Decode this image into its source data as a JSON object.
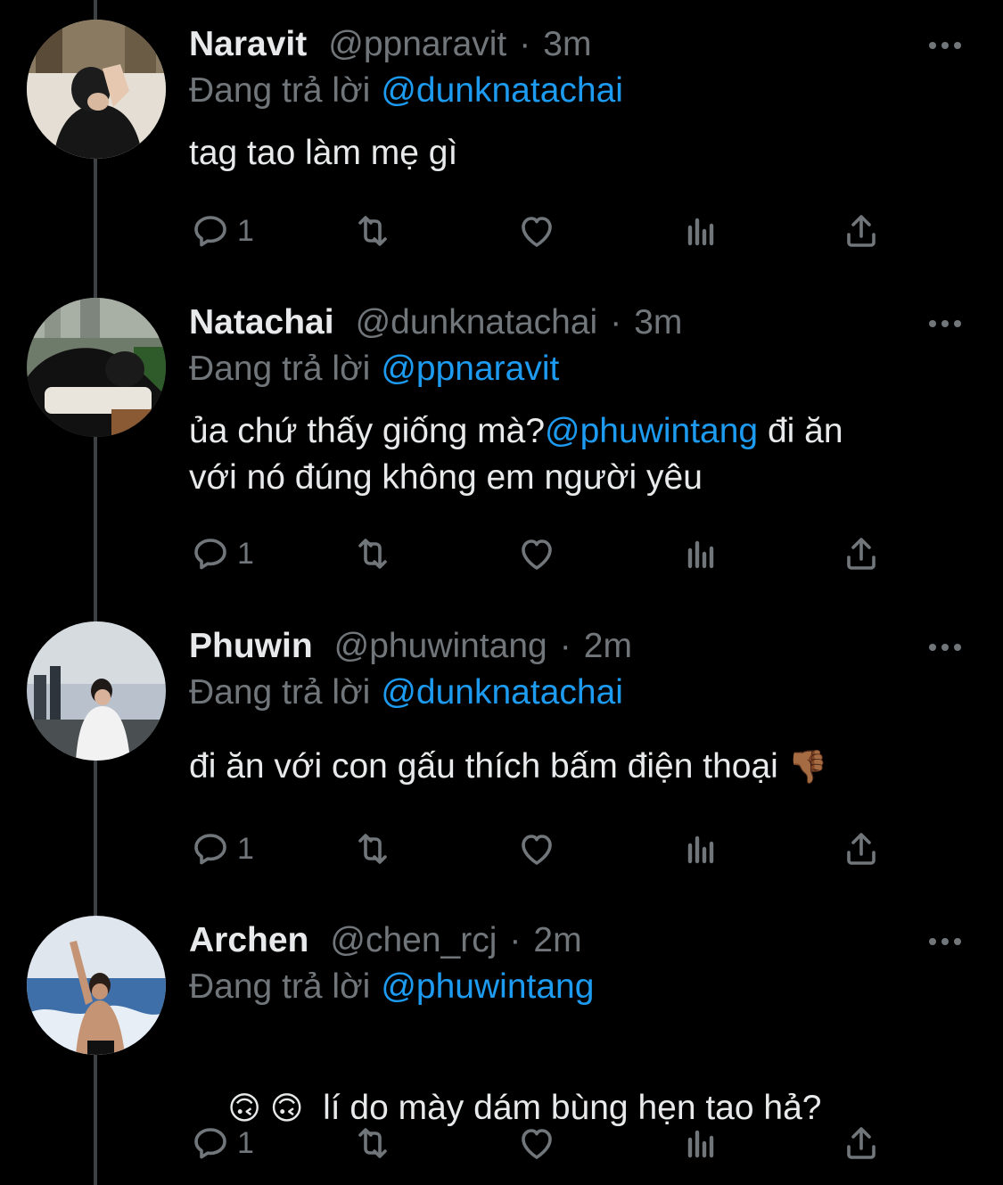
{
  "reply_prefix": "Đang trả lời",
  "tweets": [
    {
      "name": "Naravit",
      "handle": "@ppnaravit",
      "separator": "·",
      "time": "3m",
      "reply_to": "@dunknatachai",
      "text": "tag tao làm mẹ gì",
      "reply_count": "1"
    },
    {
      "name": "Natachai",
      "handle": "@dunknatachai",
      "separator": "·",
      "time": "3m",
      "reply_to": "@ppnaravit",
      "text_part1": "ủa chứ thấy giống mà?",
      "text_mention": "@phuwintang",
      "text_part2": " đi ăn",
      "text_line2": "với nó đúng không em người yêu",
      "reply_count": "1"
    },
    {
      "name": "Phuwin",
      "handle": "@phuwintang",
      "separator": "·",
      "time": "2m",
      "reply_to": "@dunknatachai",
      "text": "đi ăn với con gấu thích bấm điện thoại",
      "emoji": "👎🏾",
      "reply_count": "1"
    },
    {
      "name": "Archen",
      "handle": "@chen_rcj",
      "separator": "·",
      "time": "2m",
      "reply_to": "@phuwintang",
      "emoji": "🙃 🙃",
      "text": "  lí do mày dám bùng hẹn tao hả?",
      "reply_count": "1"
    }
  ],
  "icons": {
    "reply": "reply-icon",
    "retweet": "retweet-icon",
    "like": "heart-icon",
    "views": "analytics-icon",
    "share": "share-icon",
    "more": "more-icon"
  },
  "colors": {
    "background": "#000000",
    "text": "#e7e9ea",
    "muted": "#71767b",
    "accent": "#1d9bf0",
    "thread_line": "#3e4144"
  }
}
